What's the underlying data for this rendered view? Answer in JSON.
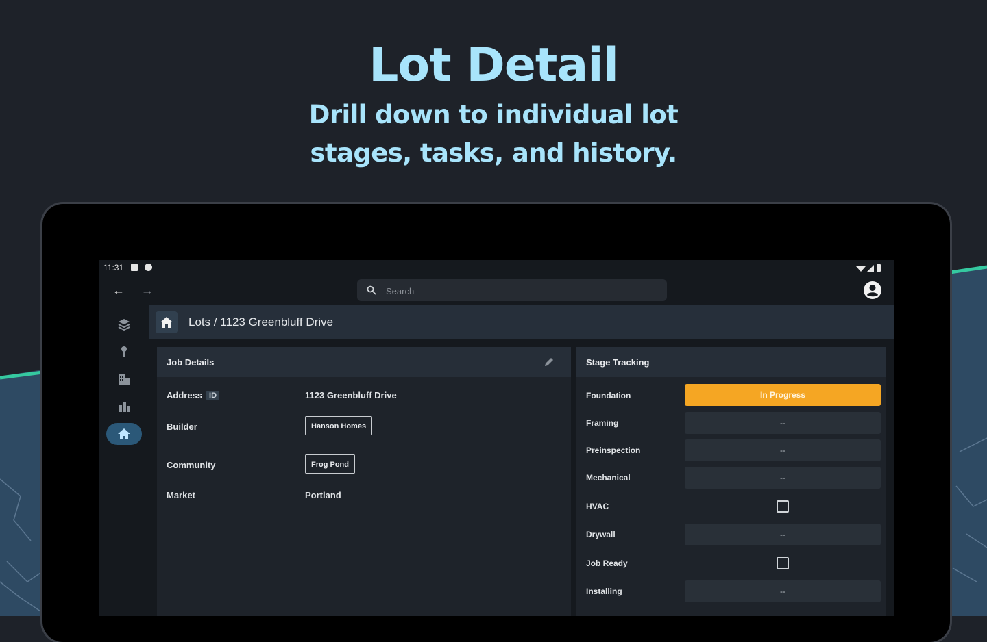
{
  "hero": {
    "title": "Lot Detail",
    "subtitle": "Drill down to individual lot stages, tasks, and history."
  },
  "statusbar": {
    "time": "11:31"
  },
  "toolbar": {
    "search_placeholder": "Search"
  },
  "breadcrumb": {
    "text": "Lots / 1123 Greenbluff Drive"
  },
  "job_details": {
    "title": "Job Details",
    "address_label": "Address",
    "address_badge": "ID",
    "address_value": "1123 Greenbluff Drive",
    "builder_label": "Builder",
    "builder_value": "Hanson Homes",
    "community_label": "Community",
    "community_value": "Frog Pond",
    "market_label": "Market",
    "market_value": "Portland"
  },
  "stage_tracking": {
    "title": "Stage Tracking",
    "stages": [
      {
        "label": "Foundation",
        "value": "In Progress",
        "kind": "progress"
      },
      {
        "label": "Framing",
        "value": "--",
        "kind": "box"
      },
      {
        "label": "Preinspection",
        "value": "--",
        "kind": "box"
      },
      {
        "label": "Mechanical",
        "value": "--",
        "kind": "box"
      },
      {
        "label": "HVAC",
        "value": "",
        "kind": "checkbox"
      },
      {
        "label": "Drywall",
        "value": "--",
        "kind": "box"
      },
      {
        "label": "Job Ready",
        "value": "",
        "kind": "checkbox"
      },
      {
        "label": "Installing",
        "value": "--",
        "kind": "box"
      }
    ]
  },
  "colors": {
    "accent": "#a8e4fb",
    "progress": "#f5a623",
    "rail_active": "#2b5878"
  }
}
